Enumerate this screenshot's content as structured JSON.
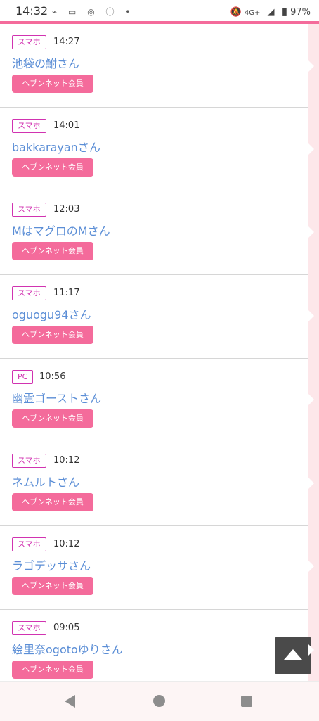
{
  "status_bar": {
    "time": "14:32",
    "left_icons": "⌁ ▭ ◎ ⓘ •",
    "network": "4G+",
    "battery": "97%"
  },
  "entries": [
    {
      "device": "スマホ",
      "time": "14:27",
      "name": "池袋の鮒さん",
      "member_label": "ヘブンネット会員"
    },
    {
      "device": "スマホ",
      "time": "14:01",
      "name": "bakkarayanさん",
      "member_label": "ヘブンネット会員"
    },
    {
      "device": "スマホ",
      "time": "12:03",
      "name": "MはマグロのMさん",
      "member_label": "ヘブンネット会員"
    },
    {
      "device": "スマホ",
      "time": "11:17",
      "name": "oguogu94さん",
      "member_label": "ヘブンネット会員"
    },
    {
      "device": "PC",
      "time": "10:56",
      "name": "幽霊ゴーストさん",
      "member_label": "ヘブンネット会員"
    },
    {
      "device": "スマホ",
      "time": "10:12",
      "name": "ネムルトさん",
      "member_label": "ヘブンネット会員"
    },
    {
      "device": "スマホ",
      "time": "10:12",
      "name": "ラゴデッサさん",
      "member_label": "ヘブンネット会員"
    },
    {
      "device": "スマホ",
      "time": "09:05",
      "name": "絵里奈ogotoゆりさん",
      "member_label": "ヘブンネット会員"
    }
  ],
  "icons": {
    "scroll_top": "triangle-up-icon",
    "nav": [
      "back-icon",
      "home-icon",
      "recent-apps-icon"
    ]
  },
  "colors": {
    "accent_pink": "#f46b9b",
    "badge_magenta": "#d133b1",
    "name_blue": "#5b8ed6",
    "side_strip": "#fde7ea"
  }
}
